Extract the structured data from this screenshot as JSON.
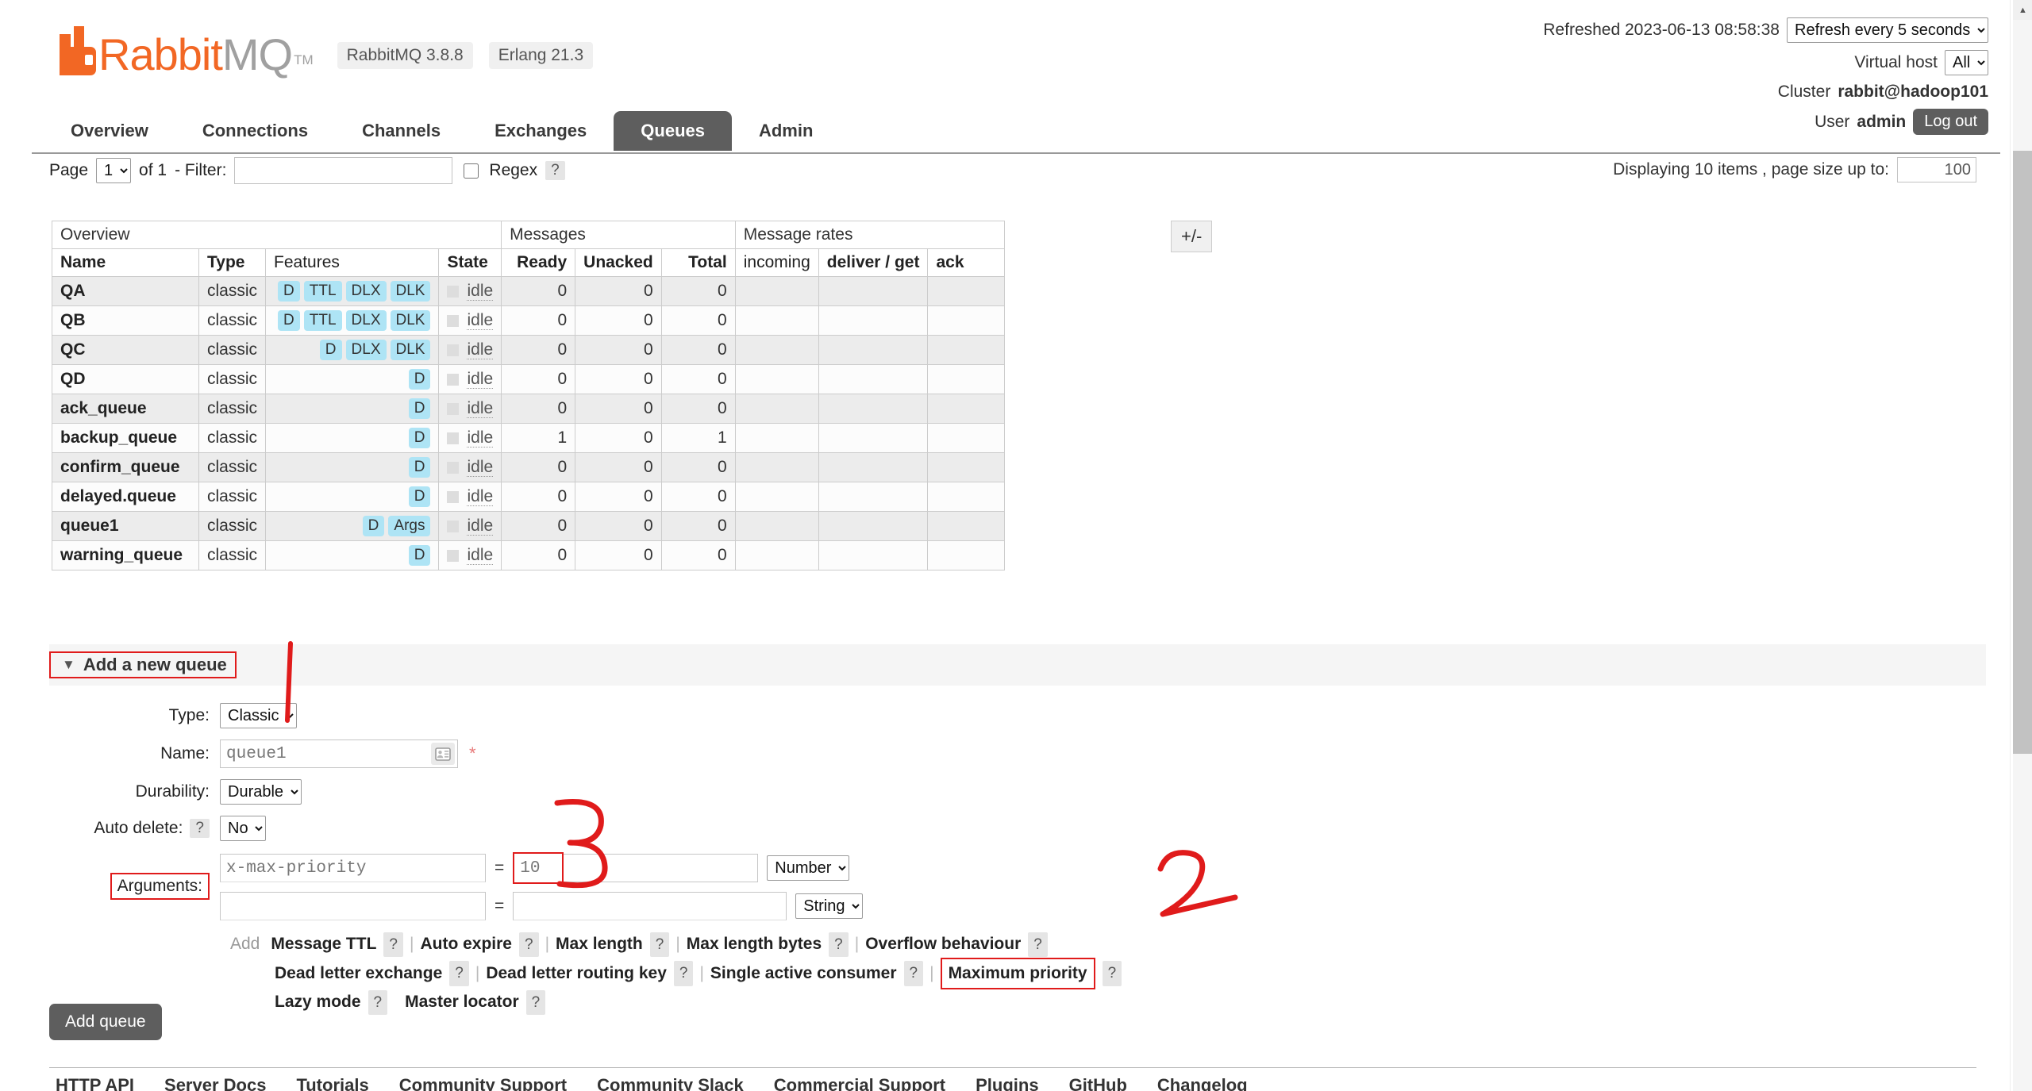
{
  "header": {
    "logo_text_primary": "Rabbit",
    "logo_text_secondary": "MQ",
    "logo_tm": "TM",
    "version_badges": [
      "RabbitMQ 3.8.8",
      "Erlang 21.3"
    ],
    "refreshed_label": "Refreshed 2023-06-13 08:58:38",
    "refresh_select": "Refresh every 5 seconds",
    "vhost_label": "Virtual host",
    "vhost_select": "All",
    "cluster_label": "Cluster",
    "cluster_name": "rabbit@hadoop101",
    "user_label": "User",
    "user_name": "admin",
    "logout_label": "Log out"
  },
  "nav": {
    "tabs": [
      {
        "label": "Overview",
        "active": false
      },
      {
        "label": "Connections",
        "active": false
      },
      {
        "label": "Channels",
        "active": false
      },
      {
        "label": "Exchanges",
        "active": false
      },
      {
        "label": "Queues",
        "active": true
      },
      {
        "label": "Admin",
        "active": false
      }
    ]
  },
  "filterbar": {
    "page_label": "Page",
    "page_value": "1",
    "of_label": "of 1",
    "filter_label": "- Filter:",
    "filter_value": "",
    "filter_placeholder": "",
    "regex_label": "Regex",
    "help_glyph": "?",
    "displaying_text": "Displaying 10 items , page size up to:",
    "page_size_value": "100"
  },
  "table": {
    "group_headers": [
      "Overview",
      "Messages",
      "Message rates"
    ],
    "expand_toggle": "+/-",
    "columns": [
      "Name",
      "Type",
      "Features",
      "State",
      "Ready",
      "Unacked",
      "Total",
      "incoming",
      "deliver / get",
      "ack"
    ],
    "rows": [
      {
        "name": "QA",
        "type": "classic",
        "features": [
          "D",
          "TTL",
          "DLX",
          "DLK"
        ],
        "state": "idle",
        "ready": "0",
        "unacked": "0",
        "total": "0",
        "incoming": "",
        "deliver_get": "",
        "ack": ""
      },
      {
        "name": "QB",
        "type": "classic",
        "features": [
          "D",
          "TTL",
          "DLX",
          "DLK"
        ],
        "state": "idle",
        "ready": "0",
        "unacked": "0",
        "total": "0",
        "incoming": "",
        "deliver_get": "",
        "ack": ""
      },
      {
        "name": "QC",
        "type": "classic",
        "features": [
          "D",
          "DLX",
          "DLK"
        ],
        "state": "idle",
        "ready": "0",
        "unacked": "0",
        "total": "0",
        "incoming": "",
        "deliver_get": "",
        "ack": ""
      },
      {
        "name": "QD",
        "type": "classic",
        "features": [
          "D"
        ],
        "state": "idle",
        "ready": "0",
        "unacked": "0",
        "total": "0",
        "incoming": "",
        "deliver_get": "",
        "ack": ""
      },
      {
        "name": "ack_queue",
        "type": "classic",
        "features": [
          "D"
        ],
        "state": "idle",
        "ready": "0",
        "unacked": "0",
        "total": "0",
        "incoming": "",
        "deliver_get": "",
        "ack": ""
      },
      {
        "name": "backup_queue",
        "type": "classic",
        "features": [
          "D"
        ],
        "state": "idle",
        "ready": "1",
        "unacked": "0",
        "total": "1",
        "incoming": "",
        "deliver_get": "",
        "ack": ""
      },
      {
        "name": "confirm_queue",
        "type": "classic",
        "features": [
          "D"
        ],
        "state": "idle",
        "ready": "0",
        "unacked": "0",
        "total": "0",
        "incoming": "",
        "deliver_get": "",
        "ack": ""
      },
      {
        "name": "delayed.queue",
        "type": "classic",
        "features": [
          "D"
        ],
        "state": "idle",
        "ready": "0",
        "unacked": "0",
        "total": "0",
        "incoming": "",
        "deliver_get": "",
        "ack": ""
      },
      {
        "name": "queue1",
        "type": "classic",
        "features": [
          "D",
          "Args"
        ],
        "state": "idle",
        "ready": "0",
        "unacked": "0",
        "total": "0",
        "incoming": "",
        "deliver_get": "",
        "ack": ""
      },
      {
        "name": "warning_queue",
        "type": "classic",
        "features": [
          "D"
        ],
        "state": "idle",
        "ready": "0",
        "unacked": "0",
        "total": "0",
        "incoming": "",
        "deliver_get": "",
        "ack": ""
      }
    ]
  },
  "add_queue": {
    "section_title": "Add a new queue",
    "type_label": "Type:",
    "type_value": "Classic",
    "name_label": "Name:",
    "name_value": "queue1",
    "name_required_mark": "*",
    "durability_label": "Durability:",
    "durability_value": "Durable",
    "autodelete_label": "Auto delete:",
    "autodelete_value": "No",
    "arguments_label": "Arguments:",
    "arg_rows": [
      {
        "key": "x-max-priority",
        "value": "10",
        "type": "Number"
      },
      {
        "key": "",
        "value": "",
        "type": "String"
      }
    ],
    "add_word": "Add",
    "quick_links_row1": [
      "Message TTL",
      "Auto expire",
      "Max length",
      "Max length bytes",
      "Overflow behaviour"
    ],
    "quick_links_row2": [
      "Dead letter exchange",
      "Dead letter routing key",
      "Single active consumer",
      "Maximum priority"
    ],
    "quick_links_row3": [
      "Lazy mode",
      "Master locator"
    ],
    "submit_label": "Add queue"
  },
  "annotations": {
    "marker_3": "3",
    "marker_2": "2",
    "highlight_color": "#e01b1b"
  },
  "footer": {
    "links": [
      "HTTP API",
      "Server Docs",
      "Tutorials",
      "Community Support",
      "Community Slack",
      "Commercial Support",
      "Plugins",
      "GitHub",
      "Changelog"
    ]
  }
}
